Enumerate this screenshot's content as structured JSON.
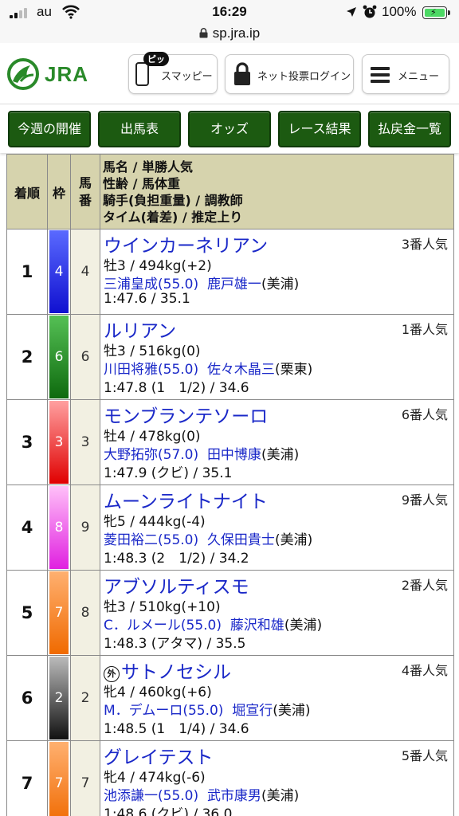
{
  "status_bar": {
    "carrier": "au",
    "time": "16:29",
    "battery": "100%"
  },
  "url_bar": {
    "url": "sp.jra.ip"
  },
  "header": {
    "logo_text": "JRA",
    "smappy_label": "スマッピー",
    "smappy_badge": "ピッ",
    "login_label": "ネット投票ログイン",
    "menu_label": "メニュー"
  },
  "nav": [
    {
      "label": "今週の開催"
    },
    {
      "label": "出馬表"
    },
    {
      "label": "オッズ"
    },
    {
      "label": "レース結果"
    },
    {
      "label": "払戻金一覧"
    }
  ],
  "table": {
    "headers": {
      "rank": "着順",
      "frame": "枠",
      "number": "馬番",
      "info_1": "馬名 / 単勝人気",
      "info_2": "性齢 / 馬体重",
      "info_3": "騎手(負担重量) / 調教師",
      "info_4": "タイム(着差) / 推定上り"
    },
    "rows": [
      {
        "rank": "1",
        "frame": "4",
        "frame_color": "#1f2fe0",
        "number": "4",
        "name": "ウインカーネリアン",
        "foreign": false,
        "popularity": "3番人気",
        "sex_age_weight": "牡3 / 494kg(+2)",
        "jockey": "三浦皇成(55.0)",
        "trainer": "鹿戸雄一",
        "trainer_loc": "(美浦)",
        "time": "1:47.6 / 35.1"
      },
      {
        "rank": "2",
        "frame": "6",
        "frame_color": "#1b8a1b",
        "number": "6",
        "name": "ルリアン",
        "foreign": false,
        "popularity": "1番人気",
        "sex_age_weight": "牡3 / 516kg(0)",
        "jockey": "川田将雅(55.0)",
        "trainer": "佐々木晶三",
        "trainer_loc": "(栗東)",
        "time": "1:47.8 (1　1/2) / 34.6"
      },
      {
        "rank": "3",
        "frame": "3",
        "frame_color": "#e02020",
        "number": "3",
        "name": "モンブランテソーロ",
        "foreign": false,
        "popularity": "6番人気",
        "sex_age_weight": "牡4 / 478kg(0)",
        "jockey": "大野拓弥(57.0)",
        "trainer": "田中博康",
        "trainer_loc": "(美浦)",
        "time": "1:47.9 (クビ) / 35.1"
      },
      {
        "rank": "4",
        "frame": "8",
        "frame_color": "#f040e0",
        "number": "9",
        "name": "ムーンライトナイト",
        "foreign": false,
        "popularity": "9番人気",
        "sex_age_weight": "牝5 / 444kg(-4)",
        "jockey": "菱田裕二(55.0)",
        "trainer": "久保田貴士",
        "trainer_loc": "(美浦)",
        "time": "1:48.3 (2　1/2) / 34.2"
      },
      {
        "rank": "5",
        "frame": "7",
        "frame_color": "#f07a18",
        "number": "8",
        "name": "アブソルティスモ",
        "foreign": false,
        "popularity": "2番人気",
        "sex_age_weight": "牡3 / 510kg(+10)",
        "jockey": "C．ルメール(55.0)",
        "trainer": "藤沢和雄",
        "trainer_loc": "(美浦)",
        "time": "1:48.3 (アタマ) / 35.5"
      },
      {
        "rank": "6",
        "frame": "2",
        "frame_color": "#222222",
        "number": "2",
        "name": "サトノセシル",
        "foreign": true,
        "foreign_mark": "外",
        "popularity": "4番人気",
        "sex_age_weight": "牝4 / 460kg(+6)",
        "jockey": "M．デムーロ(55.0)",
        "trainer": "堀宣行",
        "trainer_loc": "(美浦)",
        "time": "1:48.5 (1　1/4) / 34.6"
      },
      {
        "rank": "7",
        "frame": "7",
        "frame_color": "#f07a18",
        "number": "7",
        "name": "グレイテスト",
        "foreign": false,
        "popularity": "5番人気",
        "sex_age_weight": "牝4 / 474kg(-6)",
        "jockey": "池添謙一(55.0)",
        "trainer": "武市康男",
        "trainer_loc": "(美浦)",
        "time": "1:48.6 (クビ) / 36.0"
      }
    ]
  },
  "colors": {
    "nav_green": "#1c5a11",
    "header_beige": "#d6d3ad",
    "link_blue": "#1a28c8",
    "brand_green": "#2a8a2a"
  }
}
